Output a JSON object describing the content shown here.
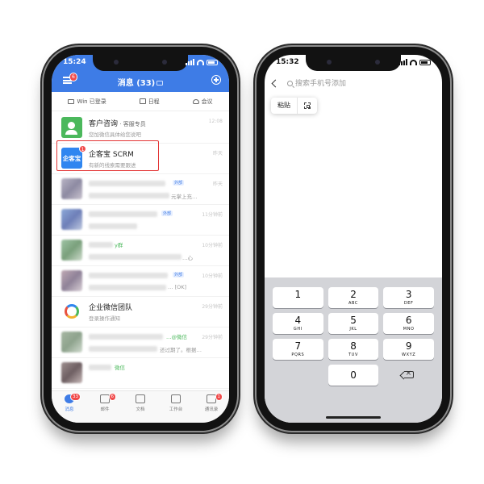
{
  "left_phone": {
    "status_time": "15:24",
    "header": {
      "title": "消息 (33)",
      "menu_badge": "6"
    },
    "quickbar": [
      {
        "label": "Win 已登录",
        "icon": "monitor-icon"
      },
      {
        "label": "日程",
        "icon": "calendar-icon"
      },
      {
        "label": "会议",
        "icon": "cloud-icon"
      }
    ],
    "messages": [
      {
        "name": "客户咨询",
        "tag": " · 客服专员",
        "preview": "您加微信具体给您说吧",
        "time": "12:08"
      },
      {
        "name": "企客宝 SCRM",
        "avatar_text": "企客宝",
        "badge": "1",
        "preview": "有新的线索需要跟进",
        "time": "昨天"
      },
      {
        "partial_preview": "元掌上充…",
        "ext_tag": "外部",
        "time": "昨天"
      },
      {
        "ext_tag": "外部",
        "time": "11分钟前"
      },
      {
        "partial_name": "y群",
        "partial_preview": "…心",
        "time": "10分钟前"
      },
      {
        "ext_tag": "外部",
        "partial_preview": "… [OK]",
        "time": "10分钟前"
      },
      {
        "name": "企业微信团队",
        "preview": "登录操作通知",
        "time": "29分钟前"
      },
      {
        "partial_name": "…@微信",
        "partial_preview": "还过期了。根据…",
        "time": "29分钟前"
      },
      {
        "partial_name": "微信",
        "time": ""
      }
    ],
    "tabs": [
      {
        "label": "消息",
        "badge": "33"
      },
      {
        "label": "邮件",
        "badge": "6"
      },
      {
        "label": "文档",
        "badge": ""
      },
      {
        "label": "工作台",
        "badge": ""
      },
      {
        "label": "通讯录",
        "badge": "1"
      }
    ]
  },
  "right_phone": {
    "status_time": "15:32",
    "search_placeholder": "搜索手机号添加",
    "paste_label": "粘贴",
    "keys": [
      [
        {
          "digit": "1",
          "letters": ""
        },
        {
          "digit": "2",
          "letters": "ABC"
        },
        {
          "digit": "3",
          "letters": "DEF"
        }
      ],
      [
        {
          "digit": "4",
          "letters": "GHI"
        },
        {
          "digit": "5",
          "letters": "JKL"
        },
        {
          "digit": "6",
          "letters": "MNO"
        }
      ],
      [
        {
          "digit": "7",
          "letters": "PQRS"
        },
        {
          "digit": "8",
          "letters": "TUV"
        },
        {
          "digit": "9",
          "letters": "WXYZ"
        }
      ]
    ],
    "zero": "0"
  },
  "colors": {
    "header_blue": "#3e7ce6",
    "highlight_red": "#e33535",
    "badge_red": "#f04a4a",
    "keypad_bg": "#d3d4d8"
  }
}
